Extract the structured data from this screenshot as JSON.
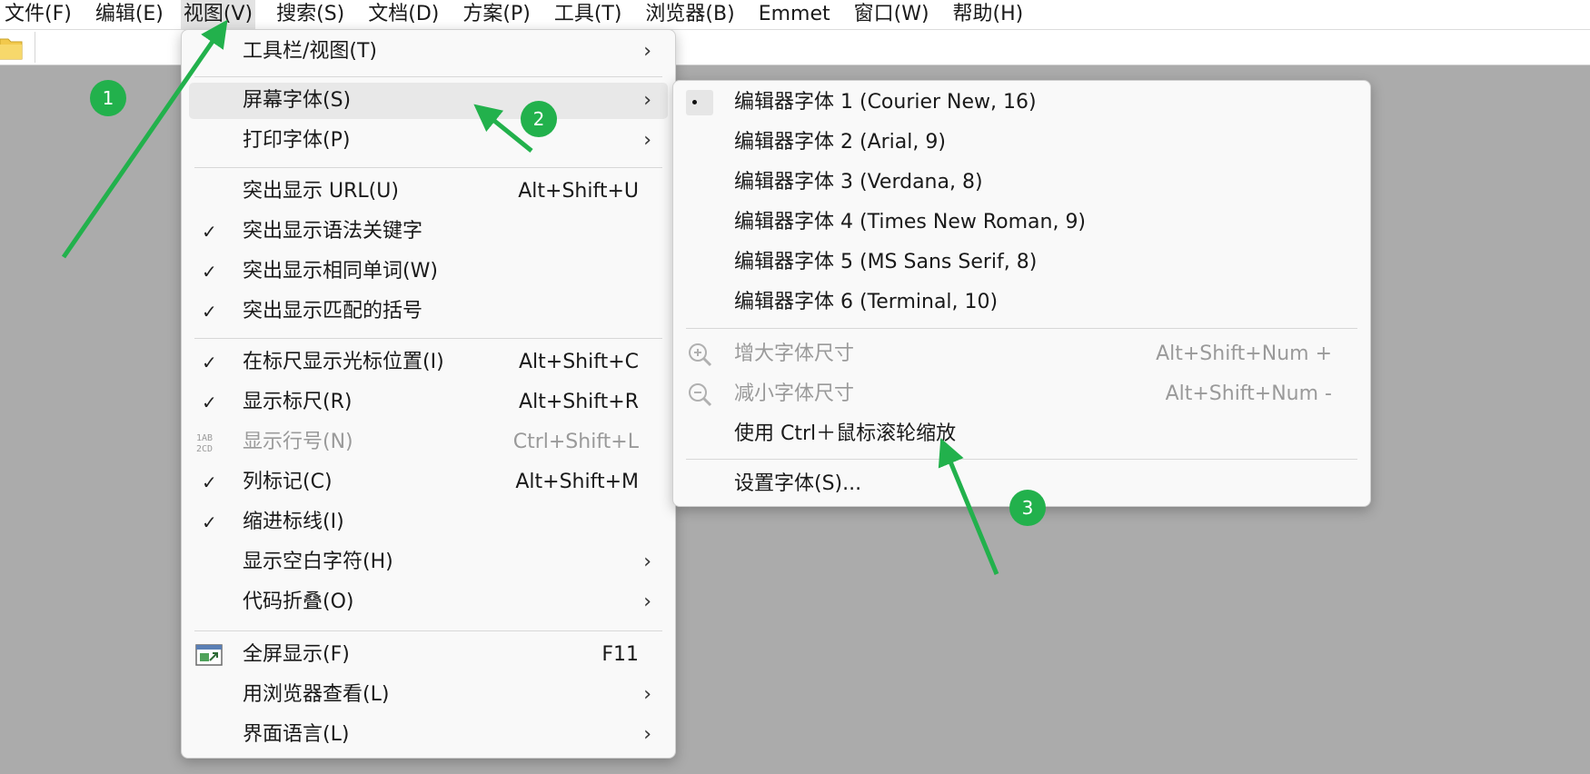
{
  "menubar": {
    "items": [
      {
        "label": "文件(F)"
      },
      {
        "label": "编辑(E)"
      },
      {
        "label": "视图(V)"
      },
      {
        "label": "搜索(S)"
      },
      {
        "label": "文档(D)"
      },
      {
        "label": "方案(P)"
      },
      {
        "label": "工具(T)"
      },
      {
        "label": "浏览器(B)"
      },
      {
        "label": "Emmet"
      },
      {
        "label": "窗口(W)"
      },
      {
        "label": "帮助(H)"
      }
    ]
  },
  "view_menu": {
    "items": [
      {
        "label": "工具栏/视图(T)",
        "submenu": true
      },
      {
        "label": "屏幕字体(S)",
        "submenu": true,
        "highlighted": true
      },
      {
        "label": "打印字体(P)",
        "submenu": true
      },
      {
        "label": "突出显示 URL(U)",
        "shortcut": "Alt+Shift+U"
      },
      {
        "label": "突出显示语法关键字",
        "checked": true
      },
      {
        "label": "突出显示相同单词(W)",
        "checked": true
      },
      {
        "label": "突出显示匹配的括号",
        "checked": true
      },
      {
        "label": "在标尺显示光标位置(I)",
        "shortcut": "Alt+Shift+C",
        "checked": true
      },
      {
        "label": "显示标尺(R)",
        "shortcut": "Alt+Shift+R",
        "checked": true
      },
      {
        "label": "显示行号(N)",
        "shortcut": "Ctrl+Shift+L",
        "disabled": true,
        "icon": "line-numbers-icon"
      },
      {
        "label": "列标记(C)",
        "shortcut": "Alt+Shift+M",
        "checked": true
      },
      {
        "label": "缩进标线(I)",
        "checked": true
      },
      {
        "label": "显示空白字符(H)",
        "submenu": true
      },
      {
        "label": "代码折叠(O)",
        "submenu": true
      },
      {
        "label": "全屏显示(F)",
        "shortcut": "F11",
        "icon": "fullscreen-icon"
      },
      {
        "label": "用浏览器查看(L)",
        "submenu": true
      },
      {
        "label": "界面语言(L)",
        "submenu": true
      }
    ],
    "check_glyph": "✓",
    "arrow_glyph": "›"
  },
  "font_submenu": {
    "items": [
      {
        "label": "编辑器字体 1 (Courier New, 16)",
        "selected": true
      },
      {
        "label": "编辑器字体 2 (Arial, 9)"
      },
      {
        "label": "编辑器字体 3 (Verdana, 8)"
      },
      {
        "label": "编辑器字体 4 (Times New Roman, 9)"
      },
      {
        "label": "编辑器字体 5 (MS Sans Serif, 8)"
      },
      {
        "label": "编辑器字体 6 (Terminal, 10)"
      },
      {
        "label": "增大字体尺寸",
        "shortcut": "Alt+Shift+Num +",
        "disabled": true,
        "icon": "zoom-in-icon"
      },
      {
        "label": "减小字体尺寸",
        "shortcut": "Alt+Shift+Num -",
        "disabled": true,
        "icon": "zoom-out-icon"
      },
      {
        "label": "使用 Ctrl＋鼠标滚轮缩放"
      },
      {
        "label": "设置字体(S)..."
      }
    ]
  },
  "annotations": {
    "badges": [
      "1",
      "2",
      "3"
    ],
    "color": "#22b14c"
  }
}
